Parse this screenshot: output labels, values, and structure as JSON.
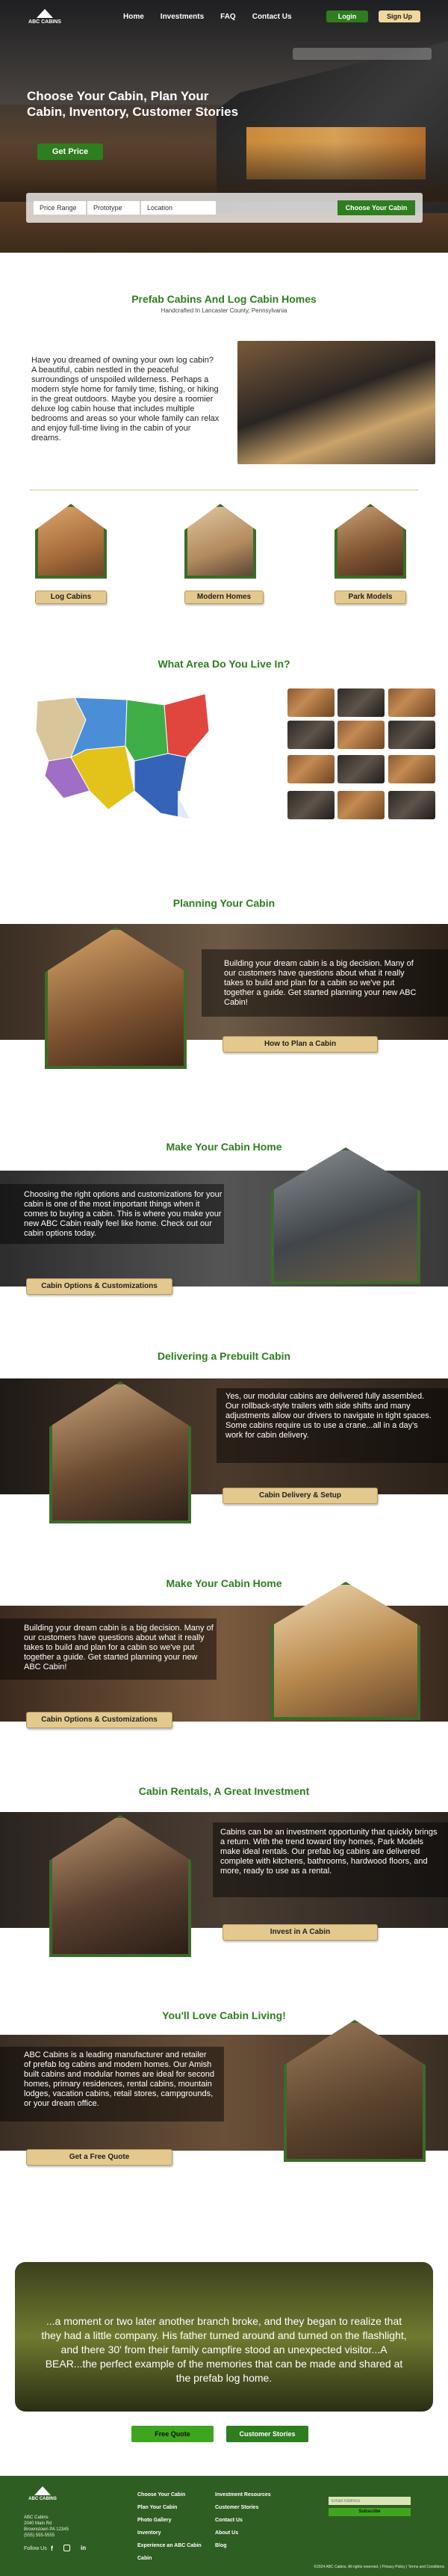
{
  "nav": {
    "logo": "ABC CABINS",
    "links": [
      "Home",
      "Investments",
      "FAQ",
      "Contact Us"
    ],
    "login": "Login",
    "signup": "Sign Up"
  },
  "hero": {
    "title": "Choose Your Cabin, Plan Your Cabin, Inventory, Customer Stories",
    "cta": "Get Price",
    "filters": [
      "Price Range",
      "Prototype",
      "Location"
    ],
    "filter_button": "Choose Your Cabin"
  },
  "intro": {
    "heading": "Prefab Cabins And Log Cabin Homes",
    "subheading": "Handcrafted In Lancaster County, Pennsylvania",
    "body": "Have you dreamed of owning your own log cabin? A beautiful, cabin nestled in the peaceful surroundings of unspoiled wilderness. Perhaps a modern style home for family time, fishing, or hiking in the great outdoors. Maybe you desire a roomier deluxe log cabin house that includes multiple bedrooms and areas so your whole family can relax and enjoy full-time living in the cabin of your dreams."
  },
  "categories": [
    "Log Cabins",
    "Modern Homes",
    "Park Models"
  ],
  "area": {
    "heading": "What Area Do You Live In?"
  },
  "planning": {
    "heading": "Planning Your Cabin",
    "body": "Building your dream cabin is a big decision. Many of our customers have questions about what it really takes to build and plan for a cabin so we've put together a guide. Get started planning your new ABC Cabin!",
    "button": "How to Plan a Cabin"
  },
  "make": {
    "heading": "Make Your Cabin Home",
    "body": "Choosing the right options and customizations for your cabin is one of the most important things when it comes to buying a cabin. This is where you make your new ABC Cabin really feel like home. Check out our cabin options today.",
    "button": "Cabin Options & Customizations"
  },
  "prebuilt": {
    "heading": "Delivering a Prebuilt Cabin",
    "body": "Yes, our modular cabins are delivered fully assembled. Our rollback-style trailers with side shifts and many adjustments allow our drivers to navigate in tight spaces. Some cabins require us to use a crane...all in a day's work for cabin delivery.",
    "button": "Cabin Delivery & Setup"
  },
  "make2": {
    "heading": "Make Your Cabin Home",
    "body": "Building your dream cabin is a big decision. Many of our customers have questions about what it really takes to build and plan for a cabin so we've put together a guide. Get started planning your new ABC Cabin!",
    "button": "Cabin Options & Customizations"
  },
  "rentals": {
    "heading": "Cabin Rentals, A Great Investment",
    "body": "Cabins can be an investment opportunity that quickly brings a return. With the trend toward tiny homes, Park Models make ideal rentals. Our prefab log cabins are delivered complete with kitchens, bathrooms, hardwood floors, and more, ready to use as a rental.",
    "button": "Invest in A Cabin"
  },
  "love": {
    "heading": "You'll Love Cabin Living!",
    "body": "ABC Cabins is a leading manufacturer and retailer of prefab log cabins and modern homes. Our Amish built cabins and modular homes are ideal for second homes, primary residences, rental cabins, mountain lodges, vacation cabins, retail stores, campgrounds, or your dream office.",
    "button": "Get a Free Quote"
  },
  "testimonial": {
    "quote": "...a moment or two later another branch broke, and they began to realize that they had a little company. His father turned around and turned on the flashlight, and there 30' from their family campfire stood an unexpected visitor...A BEAR...the perfect example of the memories that can be made and shared at the prefab log home.",
    "btn_quote": "Free Quote",
    "btn_stories": "Customer Stories"
  },
  "footer": {
    "logo": "ABC CABINS",
    "address": [
      "ABC Cabins",
      "2040 Main Rd",
      "Brownstown PA 12345",
      "(555) 555-5555"
    ],
    "follow": "Follow Us",
    "col1": [
      "Choose Your Cabin",
      "Plan Your Cabin",
      "Photo Gallery",
      "Inventory",
      "Experience an ABC Cabin",
      "Cabin"
    ],
    "col2": [
      "Investment Resources",
      "Customer Stories",
      "Contact Us",
      "About Us",
      "Blog"
    ],
    "subscribe": "Subscribe",
    "email_placeholder": "Email Address",
    "copyright": "©2024 ABC Cabins. All rights reserved. | Privacy Policy | Terms and Conditions"
  },
  "colors": {
    "brand_green": "#2e7d1e",
    "accent_tan": "#e3c98e",
    "cta_yellow": "#f0d79b"
  }
}
